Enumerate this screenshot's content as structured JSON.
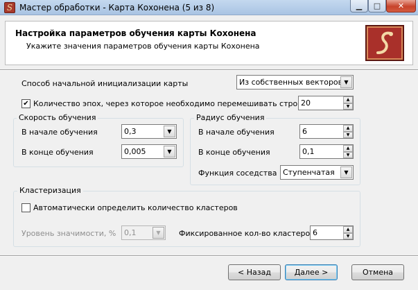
{
  "window": {
    "title": "Мастер обработки - Карта Кохонена (5 из 8)",
    "min_glyph": "▁",
    "max_glyph": "□",
    "close_glyph": "✕",
    "app_icon_glyph": "S"
  },
  "header": {
    "title": "Настройка параметров обучения карты Кохонена",
    "subtitle": "Укажите значения параметров обучения карты Кохонена",
    "logo_glyph": "S"
  },
  "init": {
    "label": "Способ начальной инициализации карты",
    "value": "Из собственных векторов"
  },
  "epochs": {
    "label": "Количество эпох, через которое необходимо перемешивать строки",
    "checked": true,
    "value": "20"
  },
  "learning_rate": {
    "title": "Скорость обучения",
    "start_label": "В начале обучения",
    "start_value": "0,3",
    "end_label": "В конце обучения",
    "end_value": "0,005"
  },
  "radius": {
    "title": "Радиус обучения",
    "start_label": "В начале обучения",
    "start_value": "6",
    "end_label": "В конце обучения",
    "end_value": "0,1",
    "neighborhood_label": "Функция соседства",
    "neighborhood_value": "Ступенчатая"
  },
  "clustering": {
    "title": "Кластеризация",
    "auto_label": "Автоматически определить количество кластеров",
    "auto_checked": false,
    "significance_label": "Уровень значимости, %",
    "significance_value": "0,1",
    "fixed_label": "Фиксированное кол-во кластеров",
    "fixed_value": "6"
  },
  "footer": {
    "back": "< Назад",
    "next": "Далее >",
    "cancel": "Отмена"
  },
  "icons": {
    "check": "✔",
    "combo_arrow": "▼",
    "spin_up": "▲",
    "spin_down": "▼"
  }
}
